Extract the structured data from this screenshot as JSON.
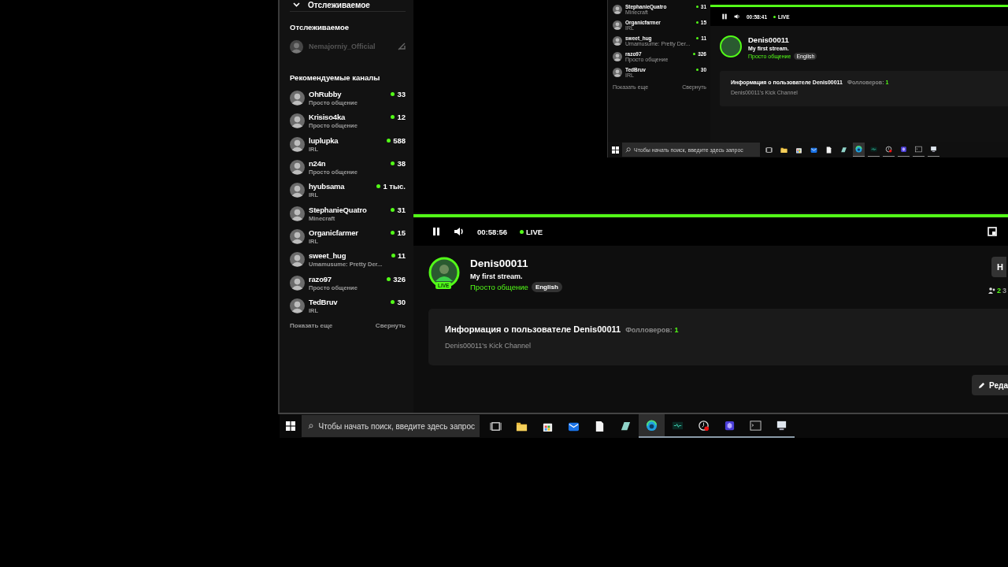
{
  "sidebar": {
    "top_heading": "Отслеживаемое",
    "followed_heading": "Отслеживаемое",
    "followed": [
      {
        "name": "Nemajorniy_Official",
        "live": false
      }
    ],
    "recommended_heading": "Рекомендуемые каналы",
    "channels": [
      {
        "name": "OhRubby",
        "category": "Просто общение",
        "viewers": "33"
      },
      {
        "name": "Krisiso4ka",
        "category": "Просто общение",
        "viewers": "12"
      },
      {
        "name": "luplupka",
        "category": "IRL",
        "viewers": "588"
      },
      {
        "name": "n24n",
        "category": "Просто общение",
        "viewers": "38"
      },
      {
        "name": "hyubsama",
        "category": "IRL",
        "viewers": "1 тыс."
      },
      {
        "name": "StephanieQuatro",
        "category": "Minecraft",
        "viewers": "31"
      },
      {
        "name": "Organicfarmer",
        "category": "IRL",
        "viewers": "15"
      },
      {
        "name": "sweet_hug",
        "category": "Umamusume: Pretty Der...",
        "viewers": "11"
      },
      {
        "name": "razo97",
        "category": "Просто общение",
        "viewers": "326"
      },
      {
        "name": "TedBruv",
        "category": "IRL",
        "viewers": "30"
      }
    ],
    "show_more": "Показать еще",
    "collapse": "Свернуть"
  },
  "mini_screen": {
    "channels": [
      {
        "name": "StephanieQuatro",
        "category": "Minecraft",
        "viewers": "31"
      },
      {
        "name": "Organicfarmer",
        "category": "IRL",
        "viewers": "15"
      },
      {
        "name": "sweet_hug",
        "category": "Umamusume: Pretty Der...",
        "viewers": "11"
      },
      {
        "name": "razo97",
        "category": "Просто общение",
        "viewers": "326"
      },
      {
        "name": "TedBruv",
        "category": "IRL",
        "viewers": "30"
      }
    ],
    "show_more": "Показать еще",
    "collapse": "Свернуть",
    "player": {
      "level": 1,
      "playing": true,
      "time": "00:58:41",
      "live_label": "LIVE"
    },
    "streamer": {
      "name": "Denis00011",
      "title": "My first stream.",
      "category": "Просто общение",
      "language": "English"
    },
    "about": {
      "heading": "Информация о пользователе Denis00011",
      "followers_label": "Фолловеров:",
      "followers": "1",
      "bio": "Denis00011's Kick Channel"
    },
    "taskbar": {
      "search_placeholder": "Чтобы начать поиск, введите здесь запрос"
    }
  },
  "player": {
    "level": 1,
    "playing": true,
    "time": "00:58:56",
    "live_label": "LIVE"
  },
  "streamer": {
    "name": "Denis00011",
    "title": "My first stream.",
    "category": "Просто общение",
    "language": "English",
    "badge": "LIVE",
    "follow_button": "Н",
    "stat_1": "2",
    "stat_2": "3"
  },
  "about": {
    "heading": "Информация о пользователе Denis00011",
    "followers_label": "Фолловеров:",
    "followers": "1",
    "bio": "Denis00011's Kick Channel"
  },
  "edit_button": "Реда",
  "taskbar": {
    "search_placeholder": "Чтобы начать поиск, введите здесь запрос",
    "apps": [
      {
        "kind": "taskview",
        "running": false,
        "selected": false
      },
      {
        "kind": "folder",
        "running": false,
        "selected": false
      },
      {
        "kind": "store",
        "running": false,
        "selected": false
      },
      {
        "kind": "mail",
        "running": false,
        "selected": false
      },
      {
        "kind": "document",
        "running": false,
        "selected": false
      },
      {
        "kind": "tile",
        "running": false,
        "selected": false
      },
      {
        "kind": "browser",
        "running": true,
        "selected": true
      },
      {
        "kind": "monitor",
        "running": true,
        "selected": false
      },
      {
        "kind": "clock",
        "running": true,
        "selected": false
      },
      {
        "kind": "cube",
        "running": true,
        "selected": false
      },
      {
        "kind": "terminal",
        "running": true,
        "selected": false
      },
      {
        "kind": "remote",
        "running": true,
        "selected": false
      }
    ]
  }
}
